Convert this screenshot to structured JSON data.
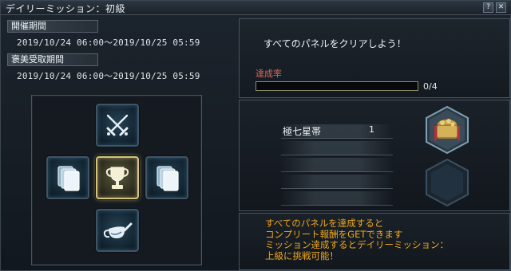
{
  "window": {
    "title": "デイリーミッション：初級",
    "help_icon": "help-icon",
    "close_icon": "close-icon",
    "help_label": "?",
    "close_label": "✕"
  },
  "period": {
    "event_label": "開催期間",
    "event_dates": "2019/10/24 06:00～2019/10/25 05:59",
    "reward_label": "褒美受取期間",
    "reward_dates": "2019/10/24 06:00～2019/10/25 05:59"
  },
  "panels": [
    {
      "name": "panel-top-swords",
      "icon": "crossed-swords-icon"
    },
    {
      "name": "panel-left-cards",
      "icon": "cards-icon"
    },
    {
      "name": "panel-center-trophy",
      "icon": "trophy-icon",
      "active": true
    },
    {
      "name": "panel-right-cards",
      "icon": "cards-icon"
    },
    {
      "name": "panel-bottom-watering",
      "icon": "watering-can-icon"
    }
  ],
  "mission": {
    "text": "すべてのパネルをクリアしよう！",
    "progress_label": "達成率",
    "progress_current": 0,
    "progress_total": 4,
    "progress_text": "0/4"
  },
  "reward": {
    "item_name": "極七星帯",
    "item_qty": "1",
    "item_icon": "gold-pouch-icon",
    "empty_slot_icon": "empty-hex-slot-icon"
  },
  "note": {
    "line1": "すべてのパネルを達成すると",
    "line2": "コンプリート報酬をGETできます",
    "line3": "ミッション達成するとデイリーミッション：",
    "line4": "上級に挑戦可能！"
  },
  "colors": {
    "note": "#f0a81e",
    "progress_label": "#d86a5a",
    "active_border": "#d8c37a"
  }
}
